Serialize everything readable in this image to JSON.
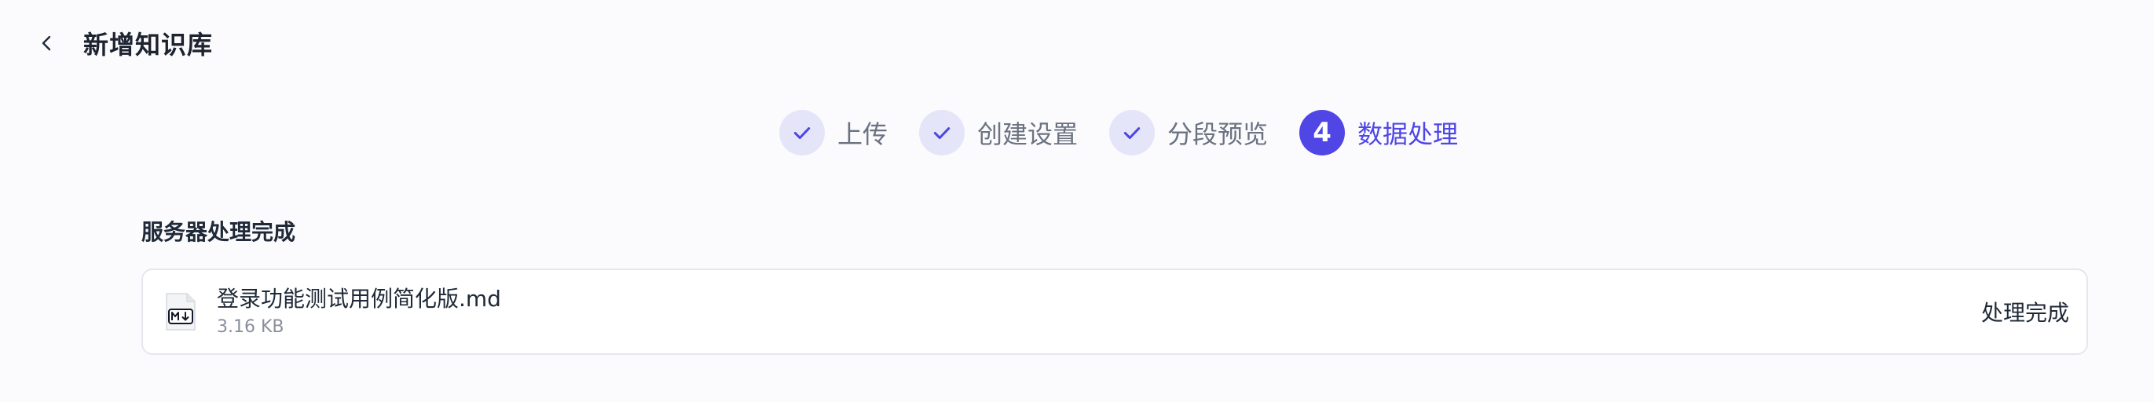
{
  "header": {
    "title": "新增知识库"
  },
  "steps": [
    {
      "label": "上传",
      "status": "done"
    },
    {
      "label": "创建设置",
      "status": "done"
    },
    {
      "label": "分段预览",
      "status": "done"
    },
    {
      "label": "数据处理",
      "status": "active",
      "number": "4"
    }
  ],
  "colors": {
    "accent": "#4f46e5",
    "done_circle": "#e4e5f8",
    "background": "#fbfbfe"
  },
  "section": {
    "title": "服务器处理完成"
  },
  "file": {
    "name": "登录功能测试用例简化版.md",
    "size": "3.16 KB",
    "status": "处理完成",
    "icon": "markdown-file-icon"
  }
}
